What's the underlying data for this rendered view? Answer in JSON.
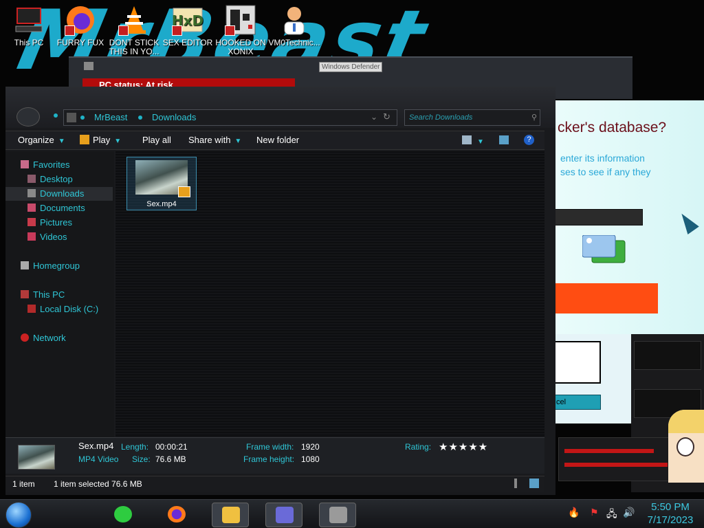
{
  "desktop": {
    "wallpaper_text": "MrBeast",
    "icons": [
      {
        "label": "This PC",
        "name": "desktop-icon-this-pc"
      },
      {
        "label": "FURRY FUX",
        "name": "desktop-icon-furry-fux"
      },
      {
        "label": "DONT STICK THIS IN YO...",
        "name": "desktop-icon-dont-stick"
      },
      {
        "label": "SEX EDITOR",
        "name": "desktop-icon-sex-editor"
      },
      {
        "label": "HOOKED ON XONIX",
        "name": "desktop-icon-hooked-on-xonix"
      },
      {
        "label": "VM0Technic...",
        "name": "desktop-icon-vm0technic"
      }
    ]
  },
  "background_window": {
    "tooltip": "Windows Defender",
    "status": "PC status: At risk"
  },
  "phish_dialog": {
    "heading": "cker's database?",
    "line1": "enter its information",
    "line2": "ses to see if any they",
    "cancel_label": "cel"
  },
  "explorer": {
    "address": {
      "crumbs": [
        "MrBeast",
        "Downloads"
      ]
    },
    "search": {
      "placeholder": "Search Downloads"
    },
    "toolbar": {
      "organize": "Organize",
      "play": "Play",
      "play_all": "Play all",
      "share_with": "Share with",
      "new_folder": "New folder"
    },
    "nav": {
      "favorites": "Favorites",
      "desktop": "Desktop",
      "downloads": "Downloads",
      "documents": "Documents",
      "pictures": "Pictures",
      "videos": "Videos",
      "homegroup": "Homegroup",
      "this_pc": "This PC",
      "local_disk": "Local Disk (C:)",
      "network": "Network"
    },
    "files": [
      {
        "name": "Sex.mp4"
      }
    ],
    "details": {
      "filename": "Sex.mp4",
      "type": "MP4 Video",
      "length_label": "Length:",
      "length": "00:00:21",
      "size_label": "Size:",
      "size": "76.6 MB",
      "frame_width_label": "Frame width:",
      "frame_width": "1920",
      "frame_height_label": "Frame height:",
      "frame_height": "1080",
      "rating_label": "Rating:",
      "rating_stars": "★★★★★"
    },
    "status": {
      "count": "1 item",
      "selection": "1 item selected  76.6 MB"
    }
  },
  "taskbar": {
    "time": "5:50 PM",
    "date": "7/17/2023"
  },
  "colors": {
    "accent": "#2fc6d6",
    "window_bg": "#191a1d",
    "wallpaper": "#1fb3d6",
    "alert": "#b30b0b",
    "phish_button": "#ff4d12"
  }
}
